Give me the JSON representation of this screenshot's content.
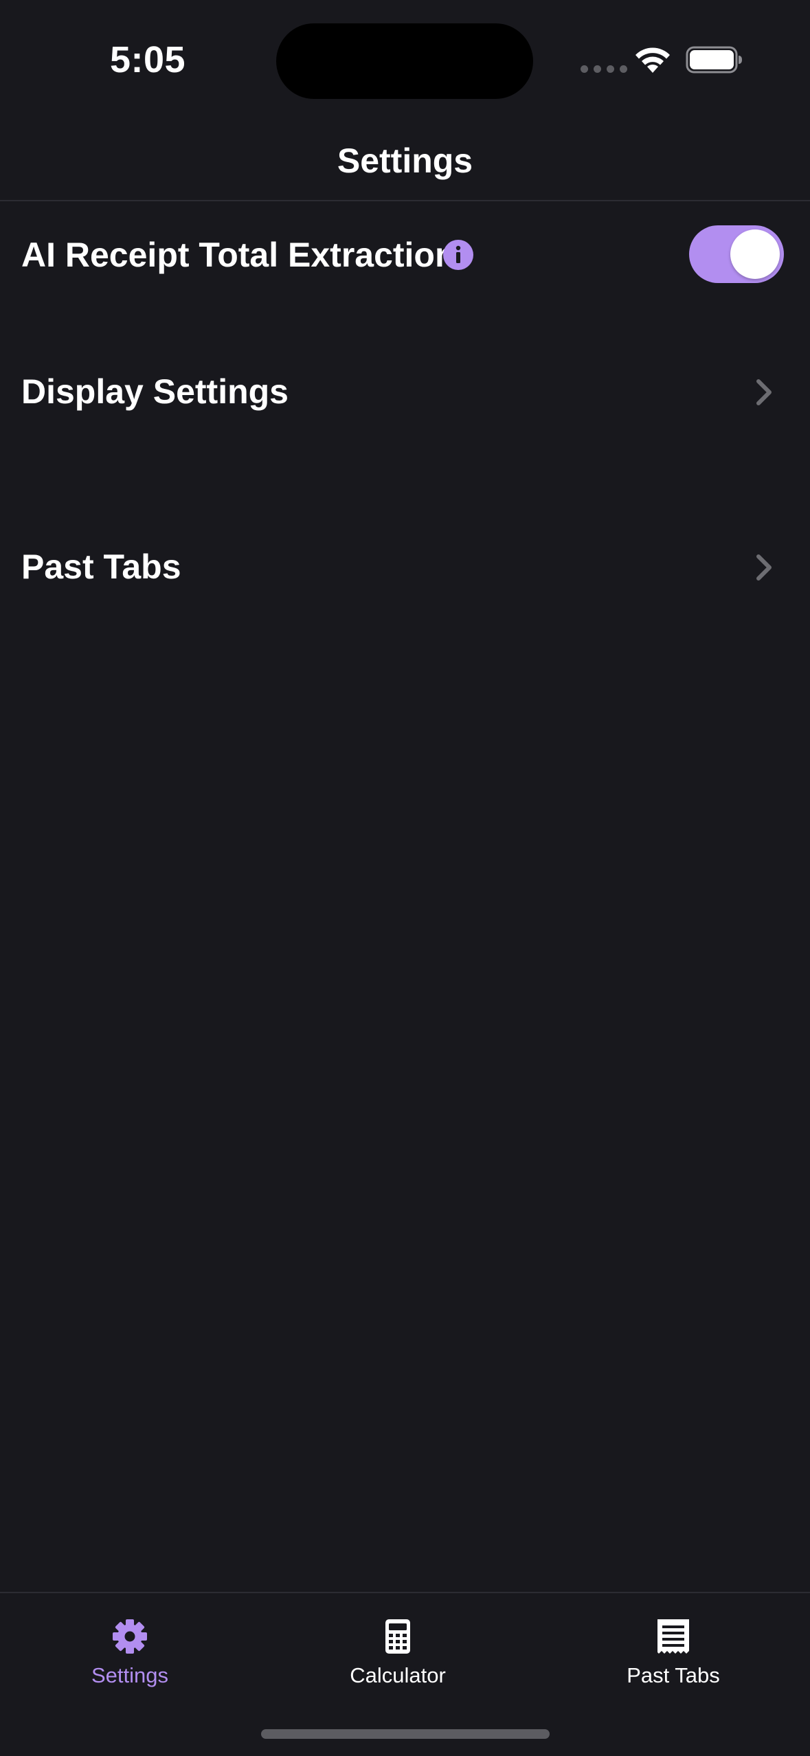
{
  "status_bar": {
    "time": "5:05"
  },
  "header": {
    "title": "Settings"
  },
  "settings": {
    "ai_extraction": {
      "label": "AI Receipt Total Extraction",
      "enabled": true
    },
    "display_settings": {
      "label": "Display Settings"
    },
    "past_tabs": {
      "label": "Past Tabs"
    }
  },
  "tab_bar": {
    "items": [
      {
        "label": "Settings",
        "icon": "gear-icon",
        "active": true
      },
      {
        "label": "Calculator",
        "icon": "calculator-icon",
        "active": false
      },
      {
        "label": "Past Tabs",
        "icon": "receipt-icon",
        "active": false
      }
    ]
  },
  "colors": {
    "background": "#18181d",
    "accent": "#b28ef0",
    "text": "#ffffff",
    "chevron": "#6d6d72"
  }
}
